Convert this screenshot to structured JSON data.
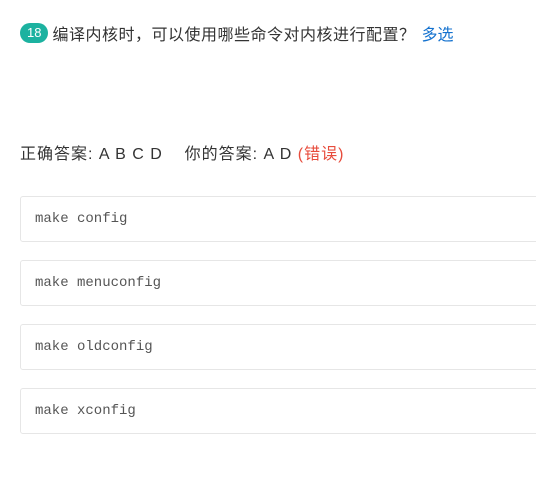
{
  "question": {
    "number": "18",
    "text": "编译内核时，可以使用哪些命令对内核进行配置？",
    "tag": "多选"
  },
  "answers": {
    "correct_label": "正确答案:",
    "correct": "A B C D",
    "your_label": "你的答案:",
    "your": "A D",
    "status": "(错误)"
  },
  "options": [
    "make config",
    "make menuconfig",
    "make oldconfig",
    "make xconfig"
  ]
}
